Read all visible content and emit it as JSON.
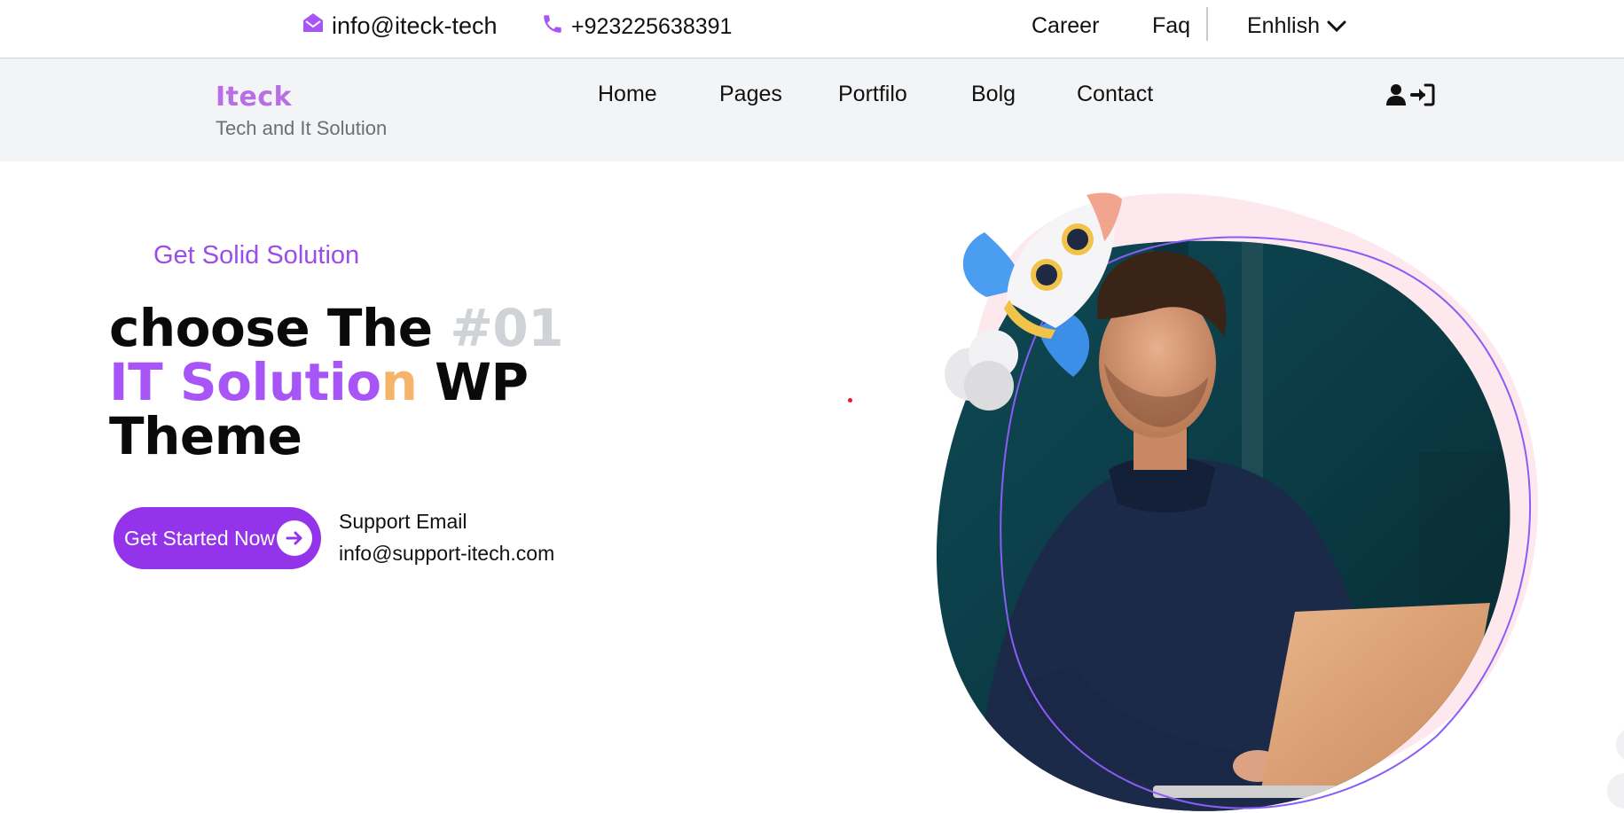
{
  "topbar": {
    "email": "info@iteck-tech",
    "phone": "+923225638391",
    "links": [
      {
        "label": "Career"
      },
      {
        "label": "Faq"
      }
    ],
    "language": "Enhlish"
  },
  "navbar": {
    "brand": "Iteck",
    "tagline": "Tech and It Solution",
    "items": [
      {
        "label": "Home"
      },
      {
        "label": "Pages"
      },
      {
        "label": "Portfilo"
      },
      {
        "label": "Bolg"
      },
      {
        "label": "Contact"
      }
    ],
    "icons": [
      "user-icon",
      "sign-in-icon"
    ]
  },
  "hero": {
    "eyebrow": "Get Solid Solution",
    "headline": {
      "part1": "choose The ",
      "part2": "#01",
      "part3": "IT Solutio",
      "part4": "n",
      "part5": " WP",
      "part6": "Theme"
    },
    "cta": "Get Started Now",
    "support_label": "Support Email",
    "support_email": "info@support-itech.com"
  },
  "colors": {
    "accent": "#9333ea",
    "brand": "#b96ee6",
    "headline_purple": "#a855f7",
    "headline_orange": "#f6b46a",
    "headline_grey": "#cfd2d6",
    "nav_bg": "#f3f4f6"
  }
}
